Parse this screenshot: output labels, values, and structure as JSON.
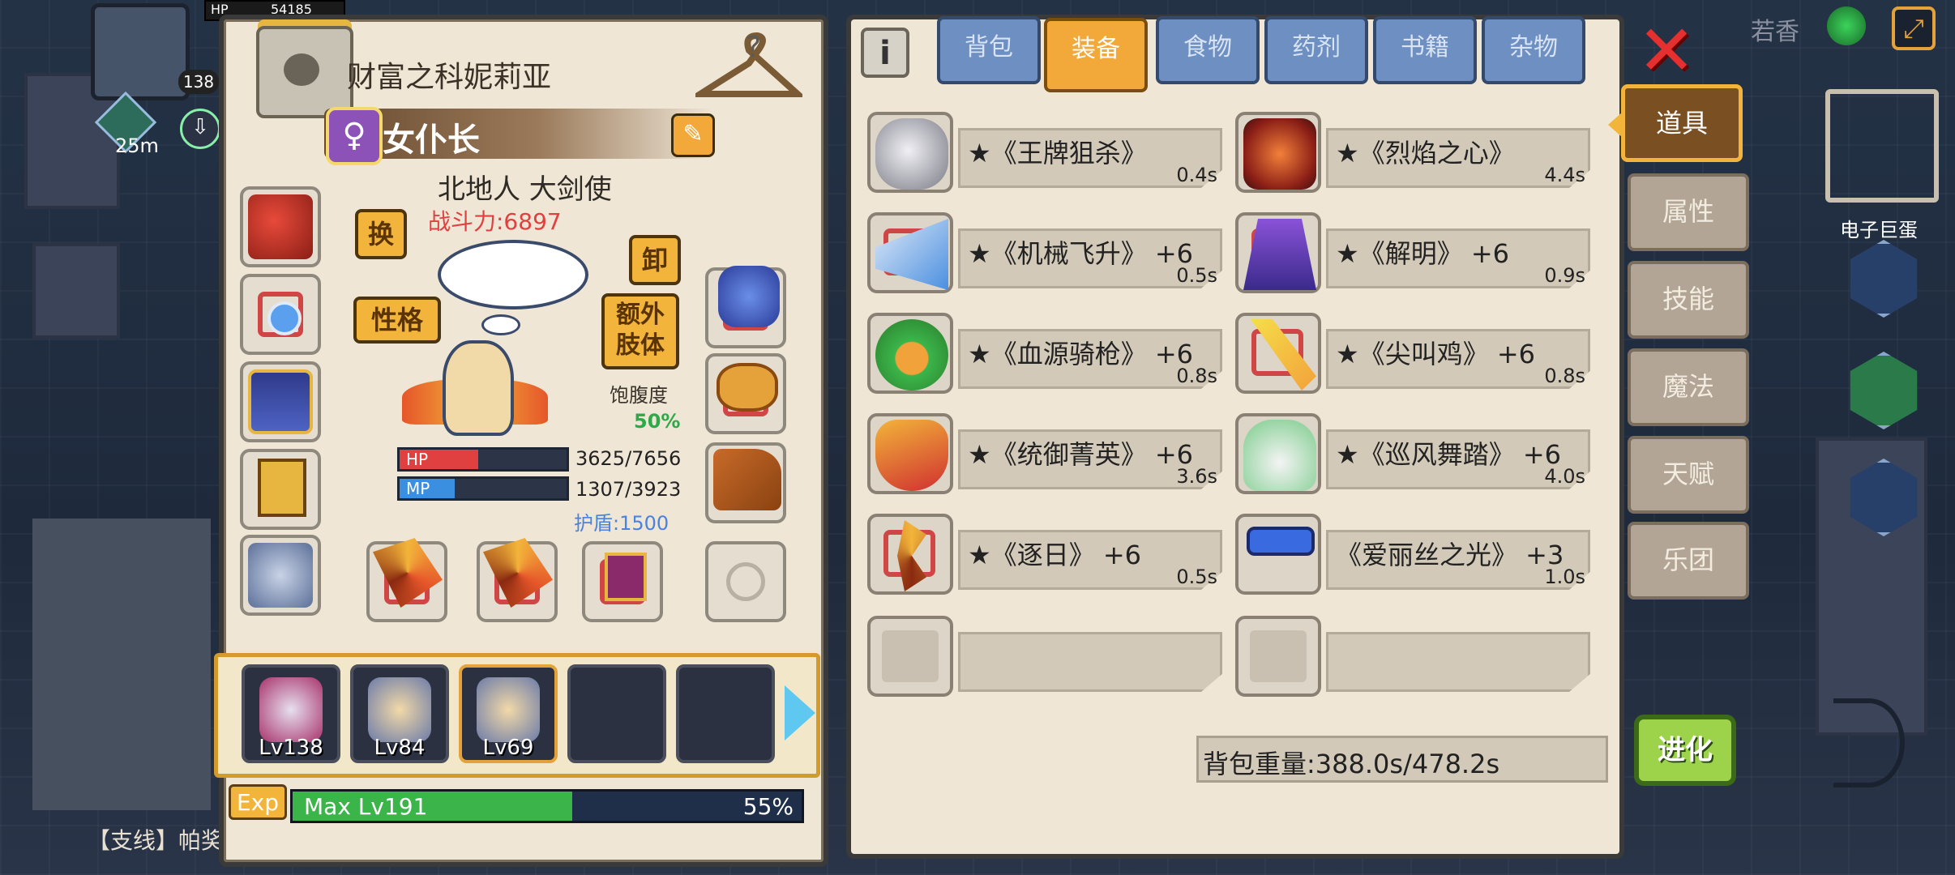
{
  "hud": {
    "hp_label": "HP",
    "hp_value": "54185",
    "level_badge": "138",
    "distance": "25m",
    "quest_text": "【支线】帕奖",
    "top_right_label": "若香",
    "map_label": "电子巨蛋"
  },
  "character": {
    "name": "财富之科妮莉亚",
    "role": "女仆长",
    "class": "北地人 大剑使",
    "power_label": "战斗力:6897",
    "swap_label": "换",
    "unequip_label": "卸",
    "personality_label": "性格",
    "extra_limb_label": "额外\n肢体",
    "satiety_label": "饱腹度",
    "satiety_value": "50%",
    "hp_label": "HP",
    "hp_text": "3625/7656",
    "hp_fraction": 0.47,
    "mp_label": "MP",
    "mp_text": "1307/3923",
    "mp_fraction": 0.33,
    "shield_text": "护盾:1500"
  },
  "team": {
    "members": [
      {
        "level": "Lv138"
      },
      {
        "level": "Lv84"
      },
      {
        "level": "Lv69"
      },
      {
        "level": ""
      },
      {
        "level": ""
      }
    ]
  },
  "exp": {
    "badge": "Exp",
    "label": "Max Lv191",
    "percent": "55%",
    "fraction": 0.55
  },
  "inventory": {
    "tabs": [
      "背包",
      "装备",
      "食物",
      "药剂",
      "书籍",
      "杂物"
    ],
    "active_tab": "装备",
    "items": [
      {
        "name": "★《王牌狙杀》",
        "weight": "0.4s"
      },
      {
        "name": "★《烈焰之心》",
        "weight": "4.4s"
      },
      {
        "name": "★《机械飞升》 +6",
        "weight": "0.5s"
      },
      {
        "name": "★《解明》 +6",
        "weight": "0.9s"
      },
      {
        "name": "★《血源骑枪》 +6",
        "weight": "0.8s"
      },
      {
        "name": "★《尖叫鸡》 +6",
        "weight": "0.8s"
      },
      {
        "name": "★《统御菁英》 +6",
        "weight": "3.6s"
      },
      {
        "name": "★《巡风舞踏》 +6",
        "weight": "4.0s"
      },
      {
        "name": "★《逐日》 +6",
        "weight": "0.5s"
      },
      {
        "name": "《爱丽丝之光》 +3",
        "weight": "1.0s"
      },
      {
        "name": "",
        "weight": ""
      },
      {
        "name": "",
        "weight": ""
      }
    ],
    "weight_label": "背包重量:388.0s/478.2s"
  },
  "side_menu": [
    "道具",
    "属性",
    "技能",
    "魔法",
    "天赋",
    "乐团"
  ],
  "evolve_label": "进化",
  "colors": {
    "panel_bg": "#efe6d6",
    "accent_orange": "#f2a93a",
    "tab_blue": "#6d8fc2",
    "hp_red": "#e04040",
    "mp_blue": "#3a8fe0",
    "exp_green": "#3bb54a"
  }
}
